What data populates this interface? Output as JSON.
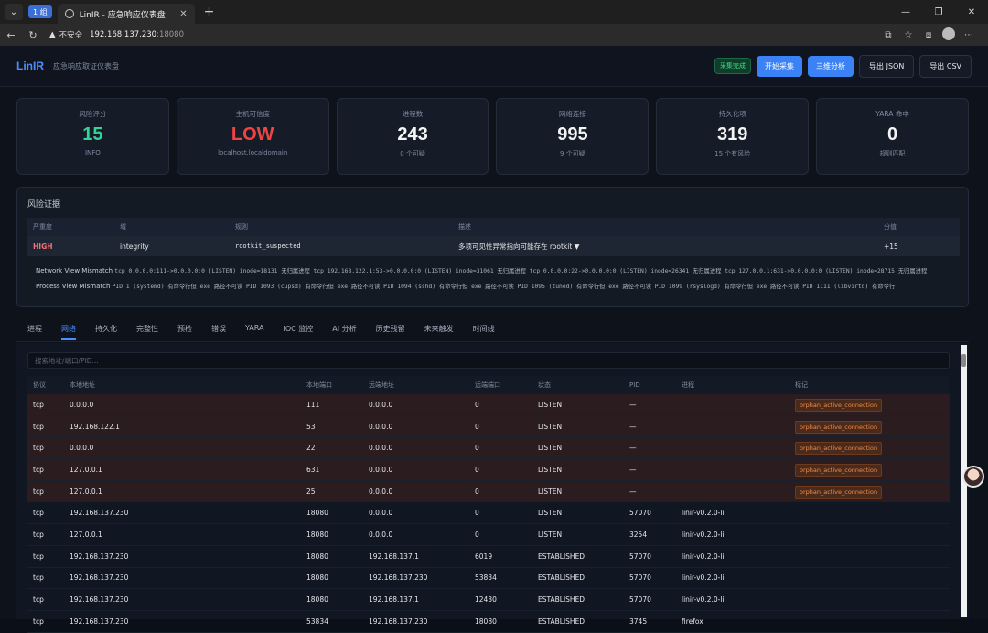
{
  "browser": {
    "group_badge": "1 组",
    "tab_title": "LinIR - 应急响应仪表盘",
    "insecure_label": "不安全",
    "url_host": "192.168.137.230",
    "url_port": ":18080"
  },
  "header": {
    "logo": "LinIR",
    "subtitle": "应急响应取证仪表盘",
    "status": "采集完成",
    "btn_collect": "开始采集",
    "btn_analyze": "三维分析",
    "btn_json": "导出 JSON",
    "btn_csv": "导出 CSV"
  },
  "cards": [
    {
      "label": "风险评分",
      "value": "15",
      "sub": "INFO"
    },
    {
      "label": "主机可信度",
      "value": "LOW",
      "sub": "localhost.localdomain"
    },
    {
      "label": "进程数",
      "value": "243",
      "sub": "0 个可疑"
    },
    {
      "label": "网络连接",
      "value": "995",
      "sub": "9 个可疑"
    },
    {
      "label": "持久化项",
      "value": "319",
      "sub": "15 个有风险"
    },
    {
      "label": "YARA 命中",
      "value": "0",
      "sub": "规则匹配"
    }
  ],
  "evidence": {
    "title": "风险证据",
    "headers": {
      "severity": "严重度",
      "domain": "域",
      "rule": "规则",
      "desc": "描述",
      "score": "分值"
    },
    "row": {
      "severity": "HIGH",
      "domain": "integrity",
      "rule": "rootkit_suspected",
      "desc": "多项可见性异常指向可能存在 rootkit ▼",
      "score": "+15"
    },
    "net_label": "Network View Mismatch",
    "net_detail": "tcp 0.0.0.0:111->0.0.0.0:0 (LISTEN) inode=18131 无归属进程  tcp 192.168.122.1:53->0.0.0.0:0 (LISTEN) inode=31061 无归属进程  tcp 0.0.0.0:22->0.0.0.0:0 (LISTEN) inode=26341 无归属进程  tcp 127.0.0.1:631->0.0.0.0:0 (LISTEN) inode=28715 无归属进程",
    "proc_label": "Process View Mismatch",
    "proc_detail": "PID 1 (systemd) 有命令行但 exe 路径不可读  PID 1093 (cupsd) 有命令行但 exe 路径不可读  PID 1094 (sshd) 有命令行但 exe 路径不可读  PID 1095 (tuned) 有命令行但 exe 路径不可读  PID 1099 (rsyslogd) 有命令行但 exe 路径不可读  PID 1111 (libvirtd) 有命令行"
  },
  "tabs": [
    "进程",
    "网络",
    "持久化",
    "完整性",
    "预检",
    "错误",
    "YARA",
    "IOC 监控",
    "AI 分析",
    "历史残留",
    "未来触发",
    "时间线"
  ],
  "network": {
    "search_placeholder": "搜索地址/端口/PID...",
    "headers": {
      "proto": "协议",
      "laddr": "本地地址",
      "lport": "本地端口",
      "raddr": "远端地址",
      "rport": "远端端口",
      "state": "状态",
      "pid": "PID",
      "proc": "进程",
      "tag": "标记"
    },
    "rows": [
      {
        "proto": "tcp",
        "laddr": "0.0.0.0",
        "lport": "111",
        "raddr": "0.0.0.0",
        "rport": "0",
        "state": "LISTEN",
        "pid": "—",
        "proc": "",
        "tag": "orphan_active_connection"
      },
      {
        "proto": "tcp",
        "laddr": "192.168.122.1",
        "lport": "53",
        "raddr": "0.0.0.0",
        "rport": "0",
        "state": "LISTEN",
        "pid": "—",
        "proc": "",
        "tag": "orphan_active_connection"
      },
      {
        "proto": "tcp",
        "laddr": "0.0.0.0",
        "lport": "22",
        "raddr": "0.0.0.0",
        "rport": "0",
        "state": "LISTEN",
        "pid": "—",
        "proc": "",
        "tag": "orphan_active_connection"
      },
      {
        "proto": "tcp",
        "laddr": "127.0.0.1",
        "lport": "631",
        "raddr": "0.0.0.0",
        "rport": "0",
        "state": "LISTEN",
        "pid": "—",
        "proc": "",
        "tag": "orphan_active_connection"
      },
      {
        "proto": "tcp",
        "laddr": "127.0.0.1",
        "lport": "25",
        "raddr": "0.0.0.0",
        "rport": "0",
        "state": "LISTEN",
        "pid": "—",
        "proc": "",
        "tag": "orphan_active_connection"
      },
      {
        "proto": "tcp",
        "laddr": "192.168.137.230",
        "lport": "18080",
        "raddr": "0.0.0.0",
        "rport": "0",
        "state": "LISTEN",
        "pid": "57070",
        "proc": "linir-v0.2.0-li",
        "tag": ""
      },
      {
        "proto": "tcp",
        "laddr": "127.0.0.1",
        "lport": "18080",
        "raddr": "0.0.0.0",
        "rport": "0",
        "state": "LISTEN",
        "pid": "3254",
        "proc": "linir-v0.2.0-li",
        "tag": ""
      },
      {
        "proto": "tcp",
        "laddr": "192.168.137.230",
        "lport": "18080",
        "raddr": "192.168.137.1",
        "rport": "6019",
        "state": "ESTABLISHED",
        "pid": "57070",
        "proc": "linir-v0.2.0-li",
        "tag": ""
      },
      {
        "proto": "tcp",
        "laddr": "192.168.137.230",
        "lport": "18080",
        "raddr": "192.168.137.230",
        "rport": "53834",
        "state": "ESTABLISHED",
        "pid": "57070",
        "proc": "linir-v0.2.0-li",
        "tag": ""
      },
      {
        "proto": "tcp",
        "laddr": "192.168.137.230",
        "lport": "18080",
        "raddr": "192.168.137.1",
        "rport": "12430",
        "state": "ESTABLISHED",
        "pid": "57070",
        "proc": "linir-v0.2.0-li",
        "tag": ""
      },
      {
        "proto": "tcp",
        "laddr": "192.168.137.230",
        "lport": "53834",
        "raddr": "192.168.137.230",
        "rport": "18080",
        "state": "ESTABLISHED",
        "pid": "3745",
        "proc": "firefox",
        "tag": ""
      }
    ]
  }
}
